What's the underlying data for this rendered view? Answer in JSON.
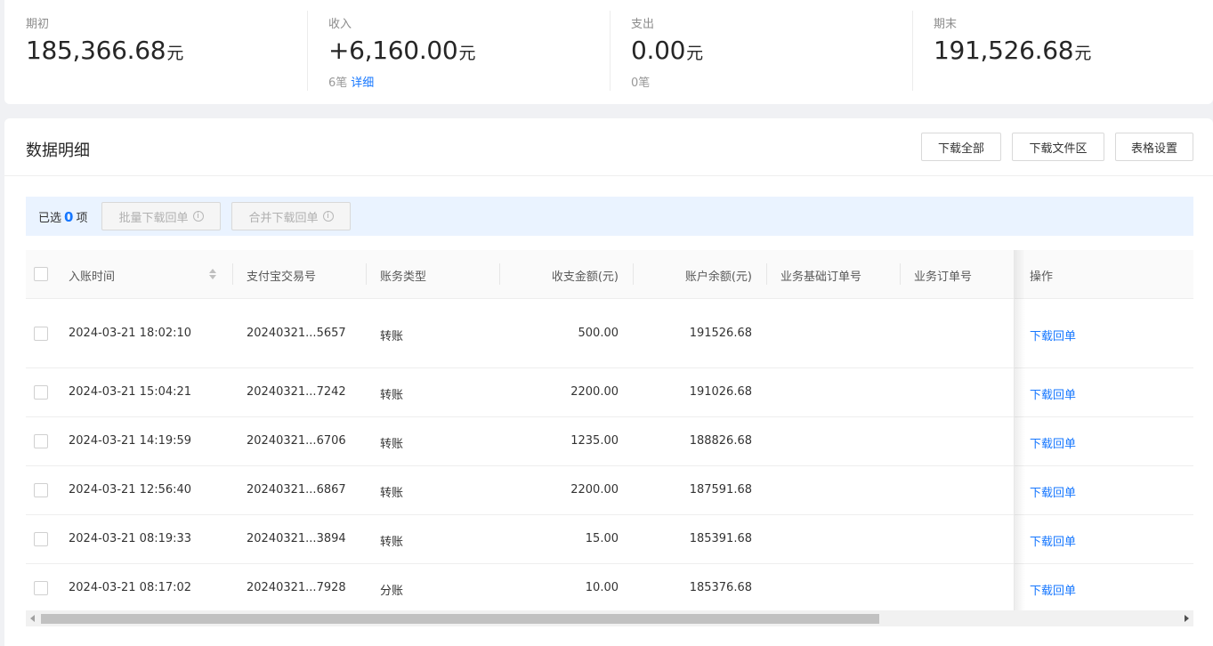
{
  "summary": {
    "opening": {
      "label": "期初",
      "amount": "185,366.68",
      "unit": "元"
    },
    "income": {
      "label": "收入",
      "amount": "+6,160.00",
      "unit": "元",
      "count": "6笔",
      "detail_link": "详细"
    },
    "expense": {
      "label": "支出",
      "amount": "0.00",
      "unit": "元",
      "count": "0笔"
    },
    "closing": {
      "label": "期末",
      "amount": "191,526.68",
      "unit": "元"
    }
  },
  "section": {
    "title": "数据明细",
    "buttons": {
      "download_all": "下载全部",
      "download_area": "下载文件区",
      "table_settings": "表格设置"
    }
  },
  "selection": {
    "prefix": "已选",
    "count": "0",
    "suffix": "项",
    "batch_download": "批量下载回单",
    "merge_download": "合并下载回单",
    "info_glyph": "i"
  },
  "table": {
    "columns": {
      "time": "入账时间",
      "trade_no": "支付宝交易号",
      "type": "账务类型",
      "amount": "收支金额(元)",
      "balance": "账户余额(元)",
      "base_order": "业务基础订单号",
      "order": "业务订单号",
      "action": "操作"
    },
    "rows": [
      {
        "time": "2024-03-21 18:02:10",
        "trade_no": "20240321...5657",
        "type": "转账",
        "amount": "500.00",
        "balance": "191526.68",
        "action": "下载回单"
      },
      {
        "time": "2024-03-21 15:04:21",
        "trade_no": "20240321...7242",
        "type": "转账",
        "amount": "2200.00",
        "balance": "191026.68",
        "action": "下载回单"
      },
      {
        "time": "2024-03-21 14:19:59",
        "trade_no": "20240321...6706",
        "type": "转账",
        "amount": "1235.00",
        "balance": "188826.68",
        "action": "下载回单"
      },
      {
        "time": "2024-03-21 12:56:40",
        "trade_no": "20240321...6867",
        "type": "转账",
        "amount": "2200.00",
        "balance": "187591.68",
        "action": "下载回单"
      },
      {
        "time": "2024-03-21 08:19:33",
        "trade_no": "20240321...3894",
        "type": "转账",
        "amount": "15.00",
        "balance": "185391.68",
        "action": "下载回单"
      },
      {
        "time": "2024-03-21 08:17:02",
        "trade_no": "20240321...7928",
        "type": "分账",
        "amount": "10.00",
        "balance": "185376.68",
        "action": "下载回单"
      }
    ]
  },
  "colors": {
    "accent": "#1677ff",
    "select_bar_bg": "#eaf3ff",
    "page_bg": "#f0f1f4"
  }
}
